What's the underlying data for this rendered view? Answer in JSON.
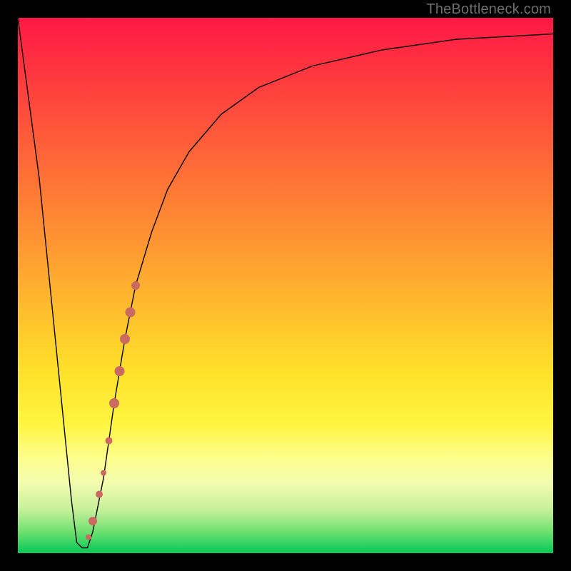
{
  "attribution": "TheBottleneck.com",
  "chart_data": {
    "type": "line",
    "title": "",
    "xlabel": "",
    "ylabel": "",
    "xlim": [
      0,
      100
    ],
    "ylim": [
      0,
      100
    ],
    "grid": false,
    "legend": false,
    "series": [
      {
        "name": "bottleneck-curve",
        "x": [
          0,
          4,
          8,
          10,
          11,
          12,
          13,
          14,
          16,
          18,
          20,
          22,
          25,
          28,
          32,
          38,
          45,
          55,
          68,
          82,
          100
        ],
        "y": [
          100,
          70,
          30,
          10,
          2,
          1,
          1,
          4,
          14,
          28,
          40,
          50,
          60,
          68,
          75,
          82,
          87,
          91,
          94,
          96,
          97
        ]
      }
    ],
    "markers": {
      "name": "highlight-band",
      "color": "#cb6a61",
      "points": [
        {
          "x": 13.2,
          "y": 3,
          "r": 4
        },
        {
          "x": 14.0,
          "y": 6,
          "r": 6
        },
        {
          "x": 15.2,
          "y": 11,
          "r": 5
        },
        {
          "x": 16.0,
          "y": 15,
          "r": 4
        },
        {
          "x": 17.0,
          "y": 21,
          "r": 5
        },
        {
          "x": 18.0,
          "y": 28,
          "r": 7
        },
        {
          "x": 19.0,
          "y": 34,
          "r": 7
        },
        {
          "x": 20.0,
          "y": 40,
          "r": 7
        },
        {
          "x": 21.0,
          "y": 45,
          "r": 7
        },
        {
          "x": 22.0,
          "y": 50,
          "r": 6
        }
      ]
    },
    "background_gradient": {
      "direction": "vertical",
      "stops": [
        {
          "pos": 0.0,
          "color": "#ff1846"
        },
        {
          "pos": 0.38,
          "color": "#ff8a33"
        },
        {
          "pos": 0.66,
          "color": "#ffe12a"
        },
        {
          "pos": 0.85,
          "color": "#f3fbb0"
        },
        {
          "pos": 1.0,
          "color": "#11c656"
        }
      ]
    }
  }
}
